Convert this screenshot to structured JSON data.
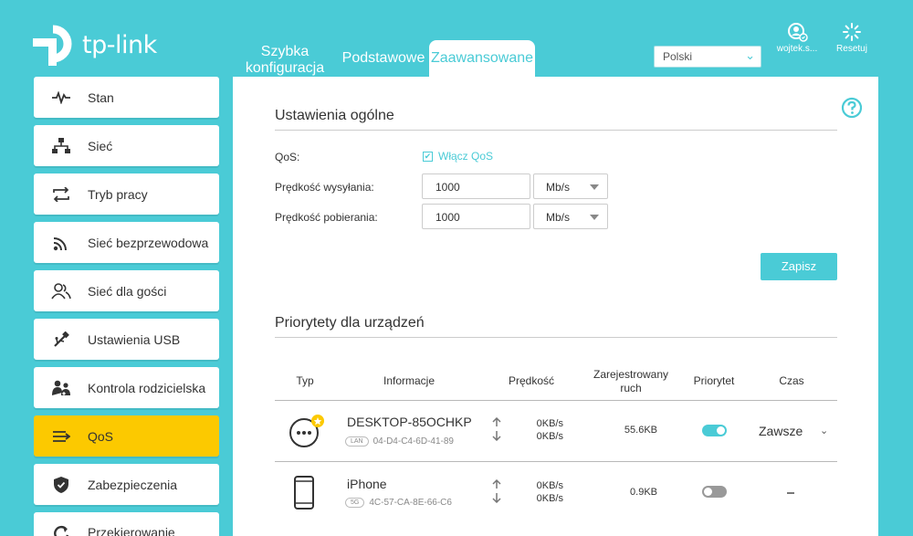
{
  "brand": {
    "name": "tp-link"
  },
  "header": {
    "tabs": [
      {
        "label_line1": "Szybka",
        "label_line2": "konfiguracja"
      },
      {
        "label": "Podstawowe"
      },
      {
        "label": "Zaawansowane"
      }
    ],
    "language": {
      "selected": "Polski"
    },
    "user_label": "wojtek.s...",
    "reset_label": "Resetuj"
  },
  "sidebar": {
    "items": [
      {
        "label": "Stan",
        "icon": "pulse-icon"
      },
      {
        "label": "Sieć",
        "icon": "network-icon"
      },
      {
        "label": "Tryb pracy",
        "icon": "mode-switch-icon"
      },
      {
        "label": "Sieć bezprzewodowa",
        "icon": "wireless-icon"
      },
      {
        "label": "Sieć dla gości",
        "icon": "guest-icon"
      },
      {
        "label": "Ustawienia USB",
        "icon": "usb-icon"
      },
      {
        "label": "Kontrola rodzicielska",
        "icon": "parental-icon"
      },
      {
        "label": "QoS",
        "icon": "qos-icon",
        "active": true
      },
      {
        "label": "Zabezpieczenia",
        "icon": "shield-icon"
      },
      {
        "label": "Przekierowanie",
        "icon": "forwarding-icon"
      }
    ]
  },
  "general": {
    "title": "Ustawienia ogólne",
    "qos_label": "QoS:",
    "qos_checkbox": "Włącz QoS",
    "qos_enabled": true,
    "upload_label": "Prędkość wysyłania:",
    "upload_value": "1000",
    "upload_unit": "Mb/s",
    "download_label": "Prędkość pobierania:",
    "download_value": "1000",
    "download_unit": "Mb/s",
    "save_label": "Zapisz"
  },
  "devices": {
    "title": "Priorytety dla urządzeń",
    "columns": {
      "type": "Typ",
      "info": "Informacje",
      "speed": "Prędkość",
      "traffic_line1": "Zarejestrowany",
      "traffic_line2": "ruch",
      "priority": "Priorytet",
      "time": "Czas"
    },
    "rows": [
      {
        "name": "DESKTOP-85OCHKP",
        "conn": "LAN",
        "mac": "04-D4-C4-6D-41-89",
        "up": "0KB/s",
        "down": "0KB/s",
        "traffic": "55.6KB",
        "priority": true,
        "time": "Zawsze",
        "icon": "generic-device-icon"
      },
      {
        "name": "iPhone",
        "conn": "5G",
        "mac": "4C-57-CA-8E-66-C6",
        "up": "0KB/s",
        "down": "0KB/s",
        "traffic": "0.9KB",
        "priority": false,
        "time": "-",
        "icon": "phone-icon"
      }
    ]
  },
  "colors": {
    "accent": "#4acbd6",
    "active": "#fcc900"
  }
}
